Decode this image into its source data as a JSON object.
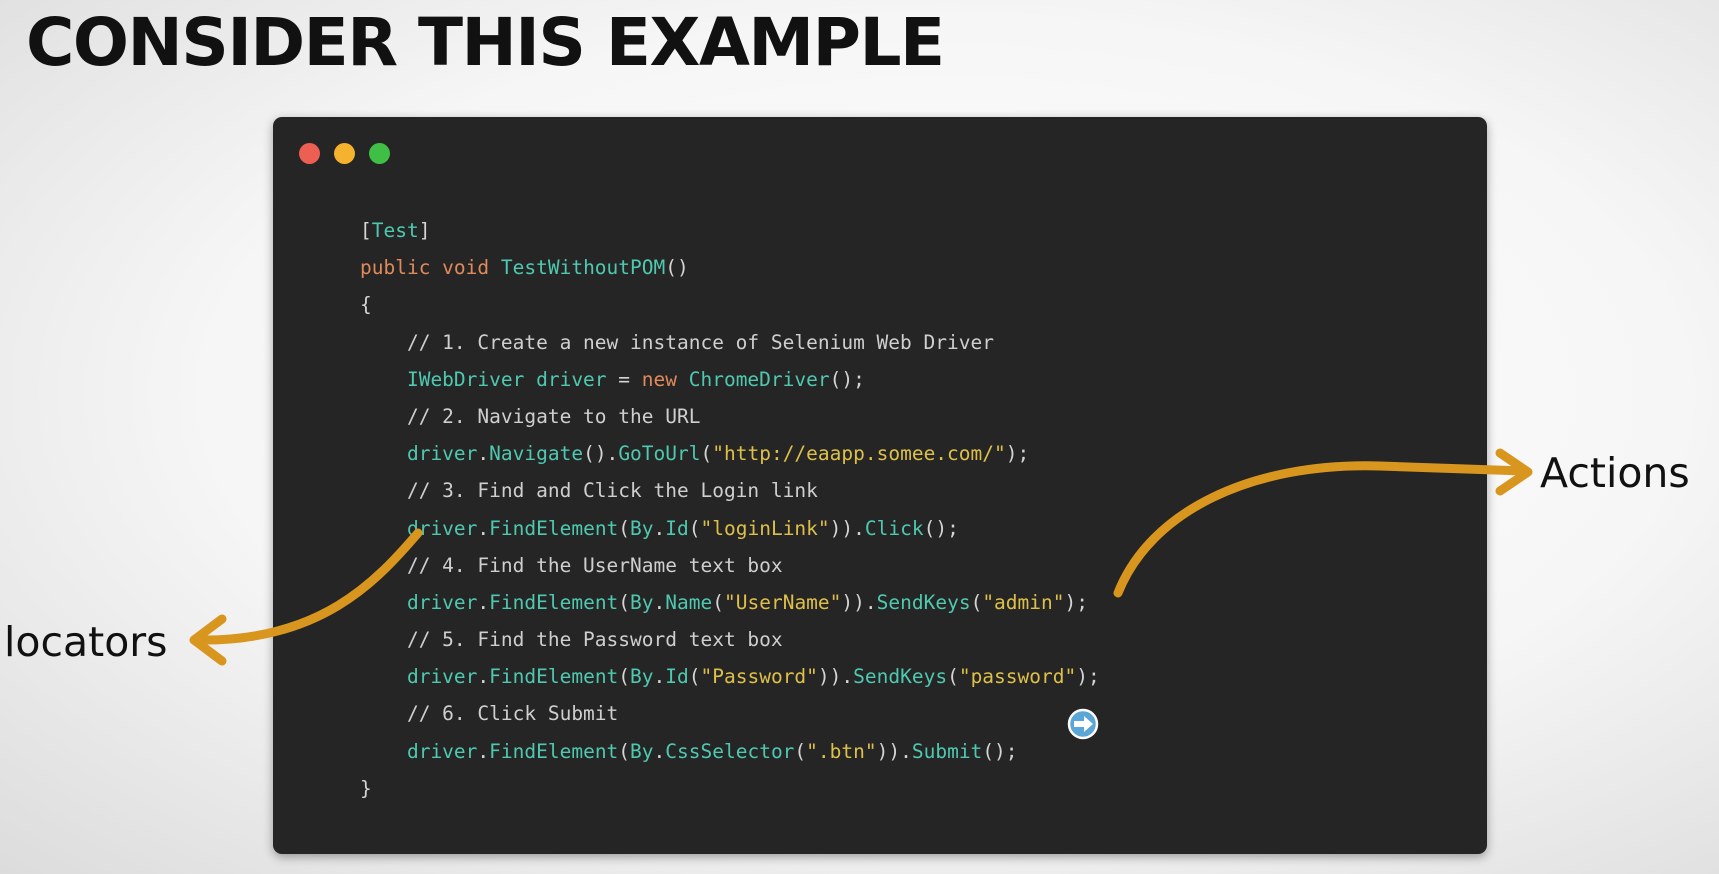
{
  "slide": {
    "title": "CONSIDER THIS EXAMPLE"
  },
  "window": {
    "controls": [
      {
        "name": "close-dot",
        "color": "#ed5f52"
      },
      {
        "name": "minimize-dot",
        "color": "#f4b22e"
      },
      {
        "name": "maximize-dot",
        "color": "#3fbf45"
      }
    ]
  },
  "code": {
    "lines": [
      [
        {
          "t": "p",
          "v": "["
        },
        {
          "t": "t",
          "v": "Test"
        },
        {
          "t": "p",
          "v": "]"
        }
      ],
      [
        {
          "t": "kw",
          "v": "public void "
        },
        {
          "t": "t",
          "v": "TestWithoutPOM"
        },
        {
          "t": "p",
          "v": "()"
        }
      ],
      [
        {
          "t": "p",
          "v": "{"
        }
      ],
      [
        {
          "t": "c",
          "v": "    // 1. Create a new instance of Selenium Web Driver"
        }
      ],
      [
        {
          "t": "t",
          "v": "    IWebDriver driver "
        },
        {
          "t": "p",
          "v": "= "
        },
        {
          "t": "kw",
          "v": "new "
        },
        {
          "t": "t",
          "v": "ChromeDriver"
        },
        {
          "t": "p",
          "v": "();"
        }
      ],
      [
        {
          "t": "c",
          "v": "    // 2. Navigate to the URL"
        }
      ],
      [
        {
          "t": "t",
          "v": "    driver"
        },
        {
          "t": "p",
          "v": "."
        },
        {
          "t": "t",
          "v": "Navigate"
        },
        {
          "t": "p",
          "v": "()."
        },
        {
          "t": "t",
          "v": "GoToUrl"
        },
        {
          "t": "p",
          "v": "("
        },
        {
          "t": "s",
          "v": "\"http://eaapp.somee.com/\""
        },
        {
          "t": "p",
          "v": ");"
        }
      ],
      [
        {
          "t": "c",
          "v": "    // 3. Find and Click the Login link"
        }
      ],
      [
        {
          "t": "t",
          "v": "    driver"
        },
        {
          "t": "p",
          "v": "."
        },
        {
          "t": "t",
          "v": "FindElement"
        },
        {
          "t": "p",
          "v": "("
        },
        {
          "t": "t",
          "v": "By"
        },
        {
          "t": "p",
          "v": "."
        },
        {
          "t": "t",
          "v": "Id"
        },
        {
          "t": "p",
          "v": "("
        },
        {
          "t": "s",
          "v": "\"loginLink\""
        },
        {
          "t": "p",
          "v": "))."
        },
        {
          "t": "t",
          "v": "Click"
        },
        {
          "t": "p",
          "v": "();"
        }
      ],
      [
        {
          "t": "c",
          "v": "    // 4. Find the UserName text box"
        }
      ],
      [
        {
          "t": "t",
          "v": "    driver"
        },
        {
          "t": "p",
          "v": "."
        },
        {
          "t": "t",
          "v": "FindElement"
        },
        {
          "t": "p",
          "v": "("
        },
        {
          "t": "t",
          "v": "By"
        },
        {
          "t": "p",
          "v": "."
        },
        {
          "t": "t",
          "v": "Name"
        },
        {
          "t": "p",
          "v": "("
        },
        {
          "t": "s",
          "v": "\"UserName\""
        },
        {
          "t": "p",
          "v": "))."
        },
        {
          "t": "t",
          "v": "SendKeys"
        },
        {
          "t": "p",
          "v": "("
        },
        {
          "t": "s",
          "v": "\"admin\""
        },
        {
          "t": "p",
          "v": ");"
        }
      ],
      [
        {
          "t": "c",
          "v": "    // 5. Find the Password text box"
        }
      ],
      [
        {
          "t": "t",
          "v": "    driver"
        },
        {
          "t": "p",
          "v": "."
        },
        {
          "t": "t",
          "v": "FindElement"
        },
        {
          "t": "p",
          "v": "("
        },
        {
          "t": "t",
          "v": "By"
        },
        {
          "t": "p",
          "v": "."
        },
        {
          "t": "t",
          "v": "Id"
        },
        {
          "t": "p",
          "v": "("
        },
        {
          "t": "s",
          "v": "\"Password\""
        },
        {
          "t": "p",
          "v": "))."
        },
        {
          "t": "t",
          "v": "SendKeys"
        },
        {
          "t": "p",
          "v": "("
        },
        {
          "t": "s",
          "v": "\"password\""
        },
        {
          "t": "p",
          "v": ");"
        }
      ],
      [
        {
          "t": "c",
          "v": "    // 6. Click Submit"
        }
      ],
      [
        {
          "t": "t",
          "v": "    driver"
        },
        {
          "t": "p",
          "v": "."
        },
        {
          "t": "t",
          "v": "FindElement"
        },
        {
          "t": "p",
          "v": "("
        },
        {
          "t": "t",
          "v": "By"
        },
        {
          "t": "p",
          "v": "."
        },
        {
          "t": "t",
          "v": "CssSelector"
        },
        {
          "t": "p",
          "v": "("
        },
        {
          "t": "s",
          "v": "\".btn\""
        },
        {
          "t": "p",
          "v": "))."
        },
        {
          "t": "t",
          "v": "Submit"
        },
        {
          "t": "p",
          "v": "();"
        }
      ],
      [
        {
          "t": "p",
          "v": "}"
        }
      ]
    ]
  },
  "annotations": {
    "locators_label": "locators",
    "actions_label": "Actions",
    "arrow_color": "#d9961f"
  },
  "colors": {
    "keyword": "#e08a5a",
    "type": "#4ec9b0",
    "string": "#dec048",
    "comment": "#cfcfcf",
    "punctuation": "#d4d4d4",
    "editor_background": "#252526"
  },
  "cursor": {
    "icon": "circle-arrow-cursor-icon"
  }
}
